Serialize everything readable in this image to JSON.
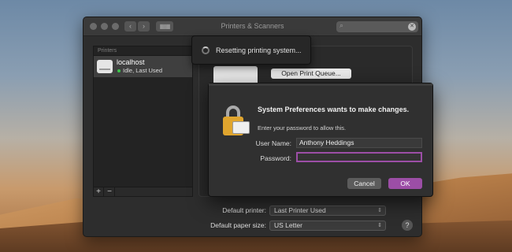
{
  "window": {
    "title": "Printers & Scanners",
    "search_placeholder": "Search",
    "printers_header": "Printers",
    "printer": {
      "name": "localhost",
      "status": "Idle, Last Used"
    },
    "add_label": "+",
    "remove_label": "−",
    "open_queue_label": "Open Print Queue...",
    "default_printer_label": "Default printer:",
    "default_printer_value": "Last Printer Used",
    "default_paper_label": "Default paper size:",
    "default_paper_value": "US Letter",
    "help_label": "?"
  },
  "popover": {
    "text": "Resetting printing system..."
  },
  "dialog": {
    "title": "System Preferences wants to make changes.",
    "message": "Enter your password to allow this.",
    "username_label": "User Name:",
    "username_value": "Anthony Heddings",
    "password_label": "Password:",
    "password_value": "",
    "cancel_label": "Cancel",
    "ok_label": "OK"
  },
  "colors": {
    "accent": "#9c4ea6",
    "status_idle": "#3cc54b",
    "lock": "#e0a52e"
  }
}
